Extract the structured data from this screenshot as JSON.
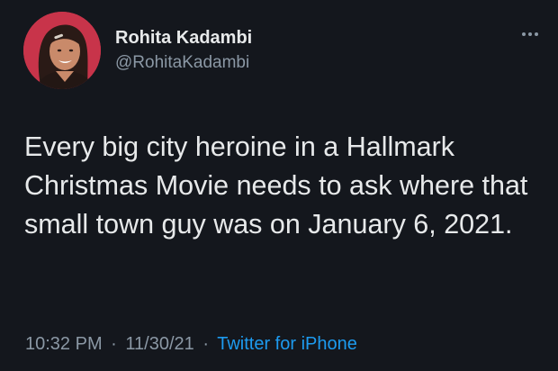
{
  "author": {
    "display_name": "Rohita Kadambi",
    "handle": "@RohitaKadambi",
    "avatar": "profile-photo"
  },
  "tweet": {
    "text": "Every big city heroine in a Hallmark Christmas Movie needs to ask where that small town guy was on January 6, 2021."
  },
  "meta": {
    "time": "10:32 PM",
    "separator": "·",
    "date": "11/30/21",
    "source": "Twitter for iPhone"
  },
  "icons": {
    "more": "more-horizontal-icon"
  },
  "colors": {
    "background": "#14171d",
    "text": "#e7e9ea",
    "secondary": "#8b98a5",
    "link": "#1d9bf0",
    "avatar_bg": "#c8344a"
  }
}
